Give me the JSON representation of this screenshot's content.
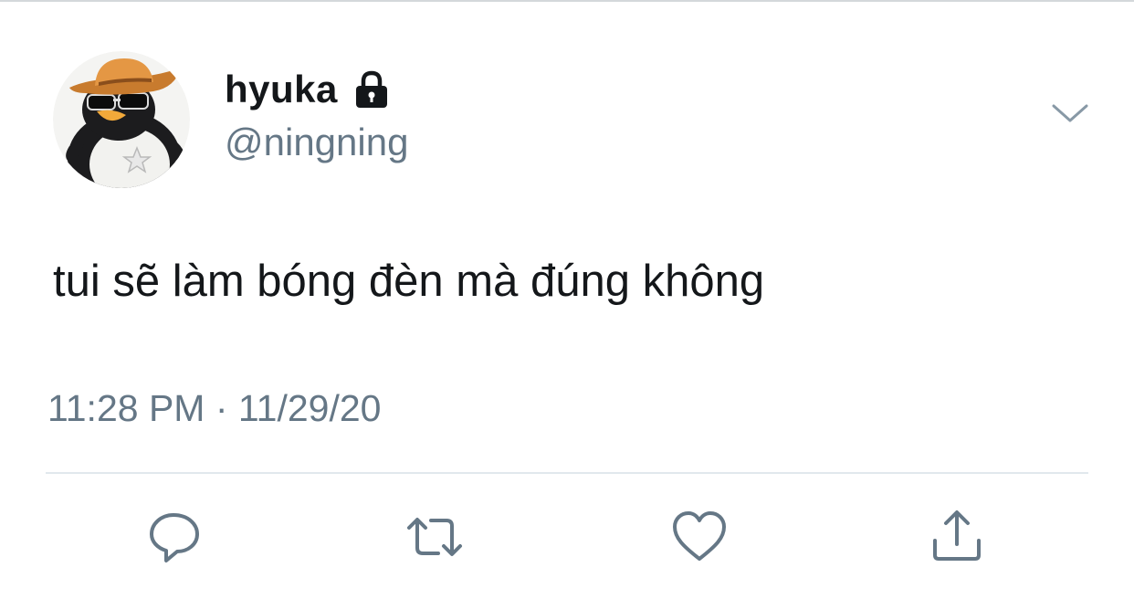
{
  "tweet": {
    "display_name": "hyuka",
    "handle": "@ningning",
    "text": "tui sẽ làm bóng đèn mà đúng không",
    "timestamp": "11:28 PM · 11/29/20",
    "protected": true
  },
  "icons": {
    "avatar": "penguin-cowboy-avatar",
    "lock": "lock-icon",
    "caret": "chevron-down-icon",
    "reply": "reply-icon",
    "retweet": "retweet-icon",
    "like": "heart-icon",
    "share": "share-icon"
  },
  "colors": {
    "text_primary": "#14171a",
    "text_secondary": "#657786",
    "divider": "#e1e8ed",
    "action_icon": "#657786"
  }
}
